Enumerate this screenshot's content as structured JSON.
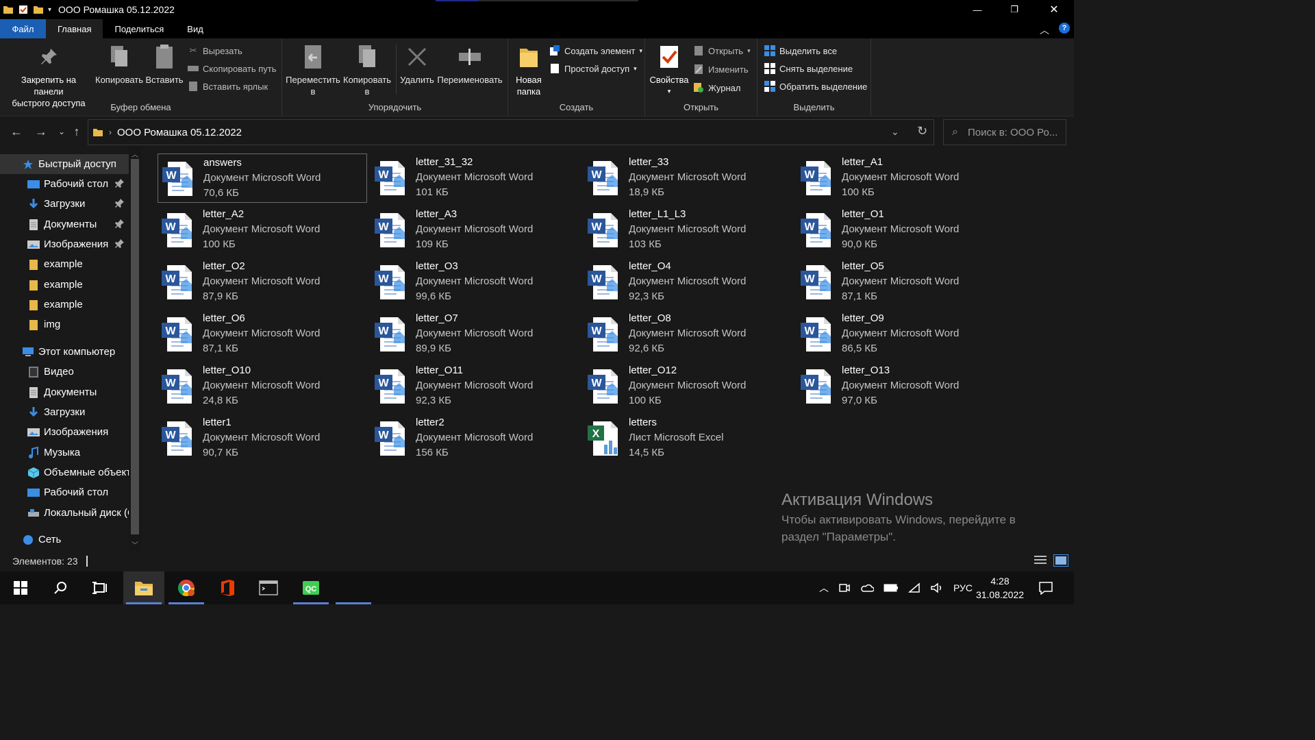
{
  "window": {
    "title": "ООО Ромашка 05.12.2022",
    "minimize_glyph": "—",
    "maximize_glyph": "❐",
    "close_glyph": "✕"
  },
  "ribbon_tabs": [
    {
      "label": "Файл"
    },
    {
      "label": "Главная"
    },
    {
      "label": "Поделиться"
    },
    {
      "label": "Вид"
    }
  ],
  "ribbon": {
    "clipboard": {
      "label": "Буфер обмена",
      "pin_line1": "Закрепить на панели",
      "pin_line2": "быстрого доступа",
      "copy": "Копировать",
      "paste": "Вставить",
      "cut": "Вырезать",
      "copy_path": "Скопировать путь",
      "paste_shortcut": "Вставить ярлык"
    },
    "organize": {
      "label": "Упорядочить",
      "move_line1": "Переместить",
      "move_line2": "в",
      "copy_line1": "Копировать",
      "copy_line2": "в",
      "delete": "Удалить",
      "rename": "Переименовать"
    },
    "create": {
      "label": "Создать",
      "new_folder_line1": "Новая",
      "new_folder_line2": "папка",
      "new_item": "Создать элемент",
      "easy_access": "Простой доступ"
    },
    "open": {
      "label": "Открыть",
      "properties": "Свойства",
      "open": "Открыть",
      "edit": "Изменить",
      "history": "Журнал"
    },
    "select": {
      "label": "Выделить",
      "select_all": "Выделить все",
      "select_none": "Снять выделение",
      "invert": "Обратить выделение"
    }
  },
  "address": {
    "path": "ООО Ромашка 05.12.2022",
    "search_placeholder": "Поиск в: ООО Ро..."
  },
  "sidebar": {
    "items": [
      {
        "label": "Быстрый доступ",
        "icon": "star-icon",
        "pinned": false
      },
      {
        "label": "Рабочий стол",
        "icon": "desktop-folder-icon",
        "pinned": true
      },
      {
        "label": "Загрузки",
        "icon": "download-folder-icon",
        "pinned": true
      },
      {
        "label": "Документы",
        "icon": "documents-folder-icon",
        "pinned": true
      },
      {
        "label": "Изображения",
        "icon": "pictures-folder-icon",
        "pinned": true
      },
      {
        "label": "example",
        "icon": "folder-icon",
        "pinned": false
      },
      {
        "label": "example",
        "icon": "folder-icon",
        "pinned": false
      },
      {
        "label": "example",
        "icon": "folder-icon",
        "pinned": false
      },
      {
        "label": "img",
        "icon": "folder-icon",
        "pinned": false
      },
      {
        "label": "Этот компьютер",
        "icon": "computer-icon",
        "pinned": false
      },
      {
        "label": "Видео",
        "icon": "videos-folder-icon",
        "pinned": false
      },
      {
        "label": "Документы",
        "icon": "documents-folder-icon",
        "pinned": false
      },
      {
        "label": "Загрузки",
        "icon": "download-folder-icon",
        "pinned": false
      },
      {
        "label": "Изображения",
        "icon": "pictures-folder-icon",
        "pinned": false
      },
      {
        "label": "Музыка",
        "icon": "music-folder-icon",
        "pinned": false
      },
      {
        "label": "Объемные объект",
        "icon": "3d-objects-icon",
        "pinned": false
      },
      {
        "label": "Рабочий стол",
        "icon": "desktop-folder-icon",
        "pinned": false
      },
      {
        "label": "Локальный диск (C",
        "icon": "drive-icon",
        "pinned": false
      },
      {
        "label": "Сеть",
        "icon": "network-icon",
        "pinned": false
      }
    ]
  },
  "files": [
    {
      "name": "answers",
      "type": "Документ Microsoft Word",
      "size": "70,6 КБ",
      "kind": "word"
    },
    {
      "name": "letter_31_32",
      "type": "Документ Microsoft Word",
      "size": "101 КБ",
      "kind": "word"
    },
    {
      "name": "letter_33",
      "type": "Документ Microsoft Word",
      "size": "18,9 КБ",
      "kind": "word"
    },
    {
      "name": "letter_A1",
      "type": "Документ Microsoft Word",
      "size": "100 КБ",
      "kind": "word"
    },
    {
      "name": "letter_A2",
      "type": "Документ Microsoft Word",
      "size": "100 КБ",
      "kind": "word"
    },
    {
      "name": "letter_A3",
      "type": "Документ Microsoft Word",
      "size": "109 КБ",
      "kind": "word"
    },
    {
      "name": "letter_L1_L3",
      "type": "Документ Microsoft Word",
      "size": "103 КБ",
      "kind": "word"
    },
    {
      "name": "letter_O1",
      "type": "Документ Microsoft Word",
      "size": "90,0 КБ",
      "kind": "word"
    },
    {
      "name": "letter_O2",
      "type": "Документ Microsoft Word",
      "size": "87,9 КБ",
      "kind": "word"
    },
    {
      "name": "letter_O3",
      "type": "Документ Microsoft Word",
      "size": "99,6 КБ",
      "kind": "word"
    },
    {
      "name": "letter_O4",
      "type": "Документ Microsoft Word",
      "size": "92,3 КБ",
      "kind": "word"
    },
    {
      "name": "letter_O5",
      "type": "Документ Microsoft Word",
      "size": "87,1 КБ",
      "kind": "word"
    },
    {
      "name": "letter_O6",
      "type": "Документ Microsoft Word",
      "size": "87,1 КБ",
      "kind": "word"
    },
    {
      "name": "letter_O7",
      "type": "Документ Microsoft Word",
      "size": "89,9 КБ",
      "kind": "word"
    },
    {
      "name": "letter_O8",
      "type": "Документ Microsoft Word",
      "size": "92,6 КБ",
      "kind": "word"
    },
    {
      "name": "letter_O9",
      "type": "Документ Microsoft Word",
      "size": "86,5 КБ",
      "kind": "word"
    },
    {
      "name": "letter_O10",
      "type": "Документ Microsoft Word",
      "size": "24,8 КБ",
      "kind": "word"
    },
    {
      "name": "letter_O11",
      "type": "Документ Microsoft Word",
      "size": "92,3 КБ",
      "kind": "word"
    },
    {
      "name": "letter_O12",
      "type": "Документ Microsoft Word",
      "size": "100 КБ",
      "kind": "word"
    },
    {
      "name": "letter_O13",
      "type": "Документ Microsoft Word",
      "size": "97,0 КБ",
      "kind": "word"
    },
    {
      "name": "letter1",
      "type": "Документ Microsoft Word",
      "size": "90,7 КБ",
      "kind": "word"
    },
    {
      "name": "letter2",
      "type": "Документ Microsoft Word",
      "size": "156 КБ",
      "kind": "word"
    },
    {
      "name": "letters",
      "type": "Лист Microsoft Excel",
      "size": "14,5 КБ",
      "kind": "excel"
    }
  ],
  "watermark": {
    "title": "Активация Windows",
    "line1": "Чтобы активировать Windows, перейдите в",
    "line2": "раздел \"Параметры\"."
  },
  "status": {
    "count": "Элементов: 23"
  },
  "taskbar": {
    "lang": "РУС",
    "time": "4:28",
    "date": "31.08.2022",
    "apps": [
      "file-explorer-icon",
      "chrome-icon",
      "office-icon",
      "terminal-icon",
      "qc-app-icon"
    ]
  },
  "colors": {
    "file_tab": "#1a5fb4",
    "word_blue": "#2b579a",
    "excel_green": "#217346",
    "folder_yellow": "#e8b84a"
  }
}
